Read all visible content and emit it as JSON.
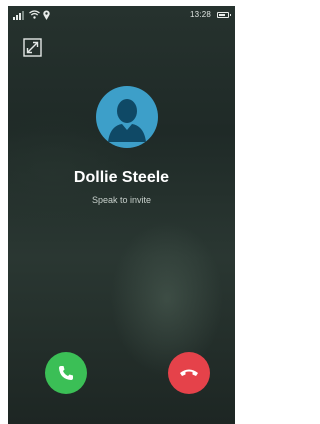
{
  "status_bar": {
    "time": "13:28",
    "battery_level": 0.7,
    "icons": [
      "signal-icon",
      "wifi-icon",
      "location-icon",
      "battery-icon"
    ]
  },
  "call": {
    "caller_name": "Dollie Steele",
    "status": "Speak to invite"
  },
  "controls": {
    "minimize_icon": "minimize-icon",
    "answer_icon": "phone-icon",
    "decline_icon": "hang-up-icon"
  },
  "colors": {
    "answer": "#3bbf56",
    "decline": "#e5424a",
    "avatar": "#3d9fc9"
  }
}
